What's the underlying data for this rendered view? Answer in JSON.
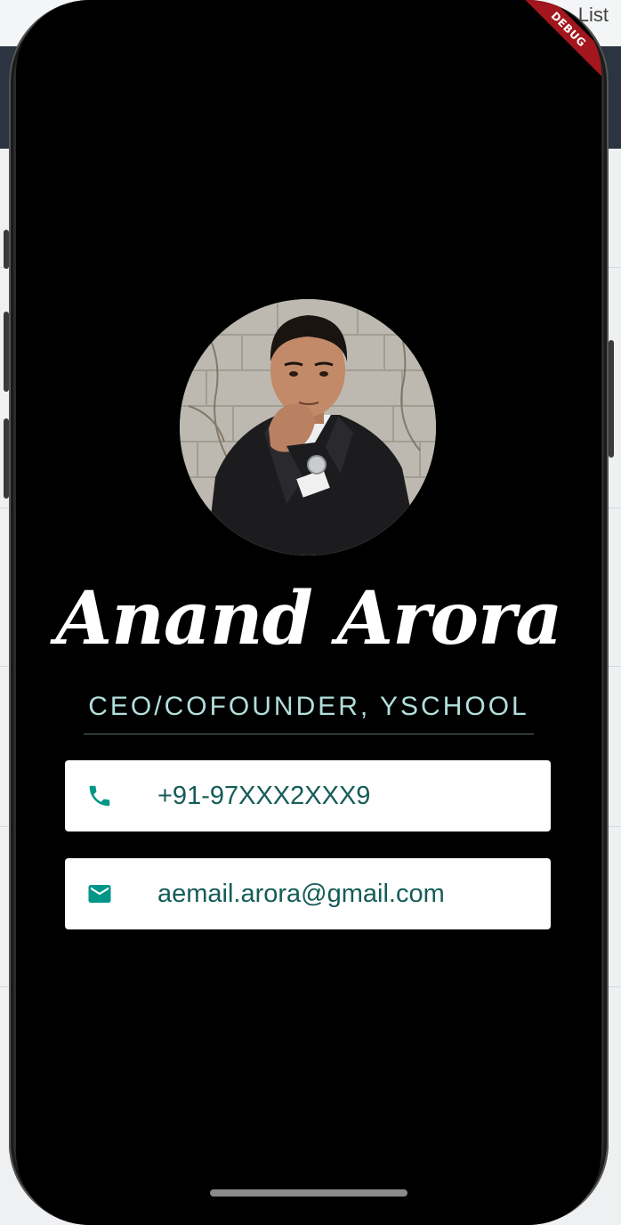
{
  "background_app": {
    "top_right_label": "List"
  },
  "debug_banner": "DEBUG",
  "profile": {
    "name": "Anand Arora",
    "title": "CEO/COFOUNDER, YSCHOOL",
    "phone": "+91-97XXX2XXX9",
    "email": "aemail.arora@gmail.com"
  },
  "icons": {
    "phone": "phone-icon",
    "email": "mail-icon"
  },
  "colors": {
    "screen_background": "#000000",
    "title_color": "#b2dfdb",
    "icon_teal": "#009688",
    "card_text": "#145c57",
    "debug_banner": "#a3161d"
  }
}
